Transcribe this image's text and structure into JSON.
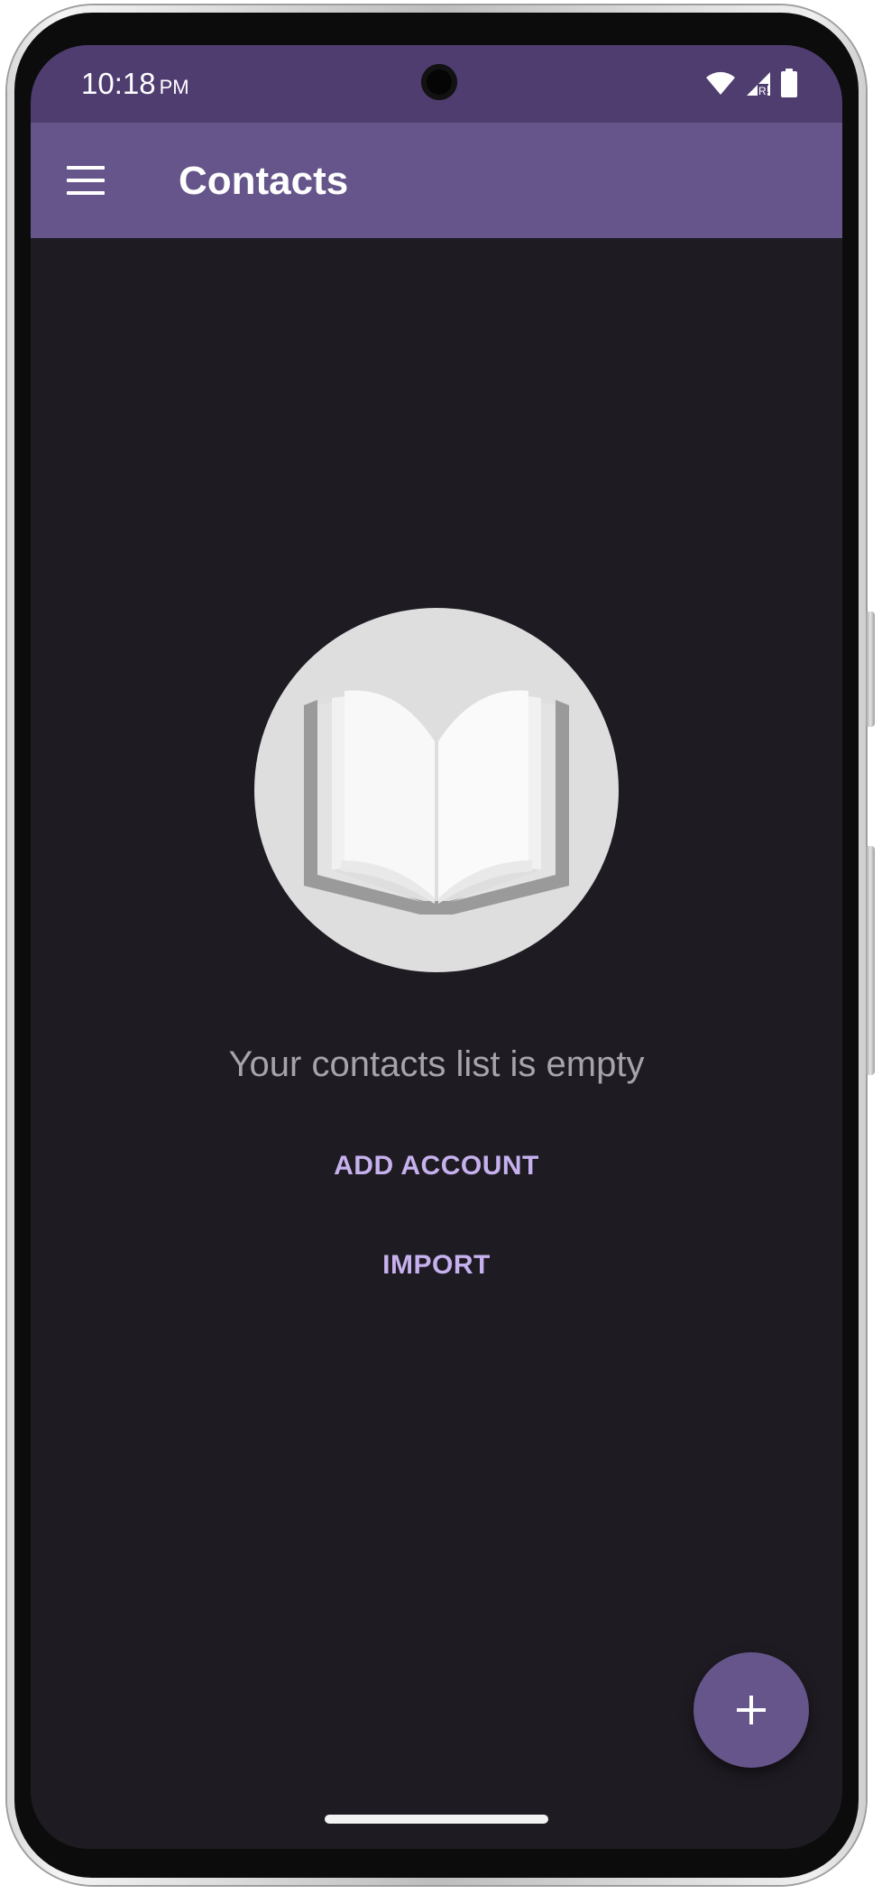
{
  "status_bar": {
    "time": "10:18",
    "ampm": "PM",
    "icons": [
      "wifi-icon",
      "signal-icon",
      "battery-icon"
    ],
    "roaming_label": "R"
  },
  "app_bar": {
    "title": "Contacts",
    "menu_icon": "hamburger-menu-icon",
    "background": "#66558a"
  },
  "empty_state": {
    "illustration": "open-book-icon",
    "message": "Your contacts list is empty",
    "actions": [
      "ADD ACCOUNT",
      "IMPORT"
    ]
  },
  "fab": {
    "icon": "plus-icon",
    "background": "#66558a"
  },
  "colors": {
    "status_bar": "#4f3d70",
    "background": "#1e1b22",
    "accent_text": "#c6b1ee",
    "muted_text": "#a6a3aa"
  }
}
